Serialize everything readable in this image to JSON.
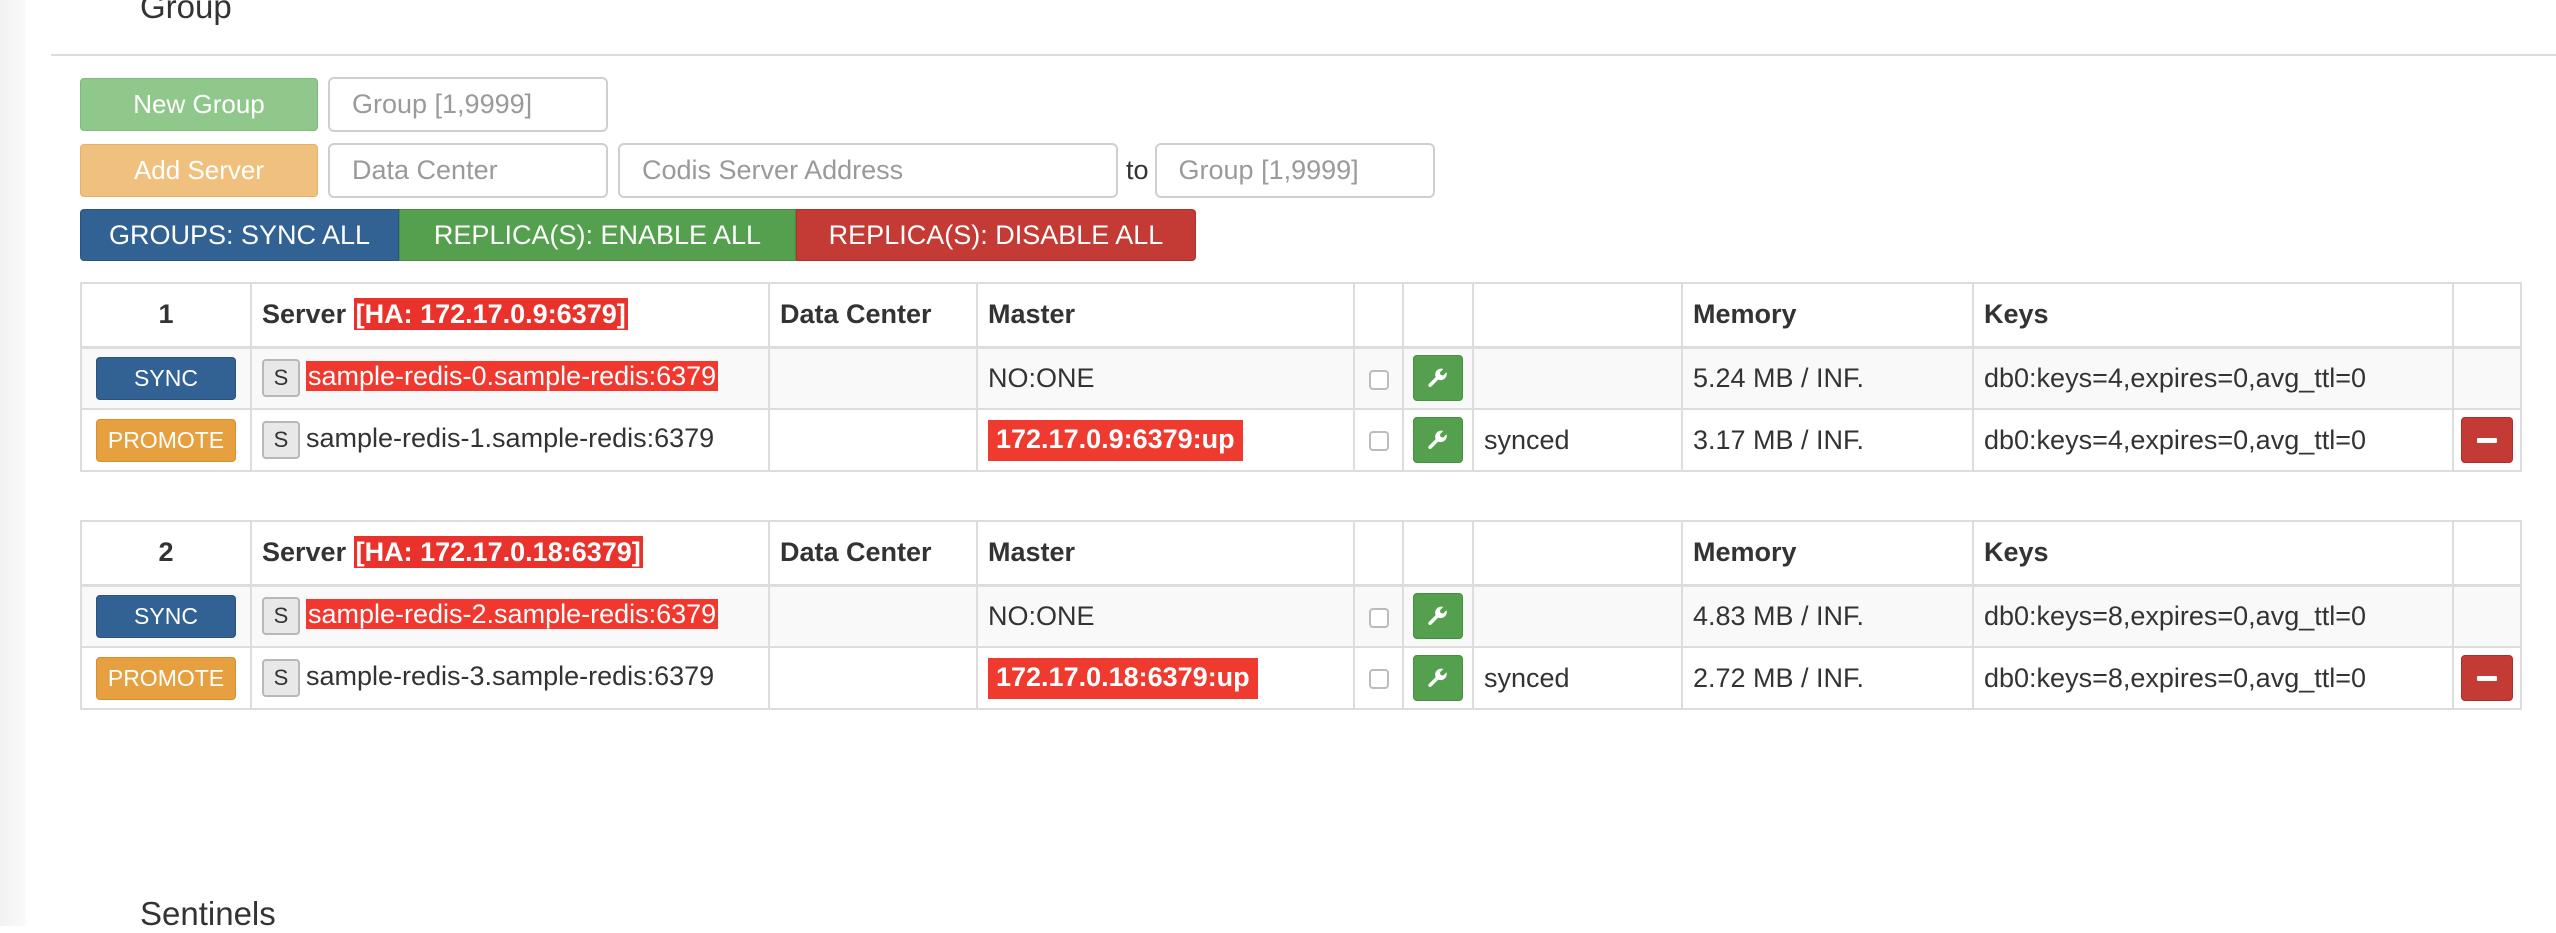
{
  "sections": {
    "group_title": "Group",
    "sentinels_title": "Sentinels"
  },
  "controls": {
    "new_group_label": "New Group",
    "group_id_placeholder": "Group [1,9999]",
    "add_server_label": "Add Server",
    "data_center_placeholder": "Data Center",
    "server_address_placeholder": "Codis Server Address",
    "to_label": "to",
    "target_group_placeholder": "Group [1,9999]"
  },
  "bulk_actions": {
    "sync_all": "GROUPS: SYNC ALL",
    "enable_all": "REPLICA(S): ENABLE ALL",
    "disable_all": "REPLICA(S): DISABLE ALL"
  },
  "columns": {
    "server": "Server",
    "data_center": "Data Center",
    "master": "Master",
    "memory": "Memory",
    "keys": "Keys"
  },
  "groups": [
    {
      "id": "1",
      "ha": "[HA: 172.17.0.9:6379]",
      "servers": [
        {
          "action": "SYNC",
          "s_label": "S",
          "address": "sample-redis-0.sample-redis:6379",
          "data_center": "",
          "master": "NO:ONE",
          "status": "",
          "memory": "5.24 MB / INF.",
          "keys": "db0:keys=4,expires=0,avg_ttl=0"
        },
        {
          "action": "PROMOTE",
          "s_label": "S",
          "address": "sample-redis-1.sample-redis:6379",
          "data_center": "",
          "master": "172.17.0.9:6379:up",
          "status": "synced",
          "memory": "3.17 MB / INF.",
          "keys": "db0:keys=4,expires=0,avg_ttl=0"
        }
      ]
    },
    {
      "id": "2",
      "ha": "[HA: 172.17.0.18:6379]",
      "servers": [
        {
          "action": "SYNC",
          "s_label": "S",
          "address": "sample-redis-2.sample-redis:6379",
          "data_center": "",
          "master": "NO:ONE",
          "status": "",
          "memory": "4.83 MB / INF.",
          "keys": "db0:keys=8,expires=0,avg_ttl=0"
        },
        {
          "action": "PROMOTE",
          "s_label": "S",
          "address": "sample-redis-3.sample-redis:6379",
          "data_center": "",
          "master": "172.17.0.18:6379:up",
          "status": "synced",
          "memory": "2.72 MB / INF.",
          "keys": "db0:keys=8,expires=0,avg_ttl=0"
        }
      ]
    }
  ],
  "colors": {
    "primary": "#326193",
    "success": "#55a04e",
    "danger": "#c43a35",
    "warning": "#e7a03f",
    "highlight_red": "#ee3a2f"
  },
  "icons": {
    "config": "wrench-icon",
    "remove": "minus-icon"
  }
}
